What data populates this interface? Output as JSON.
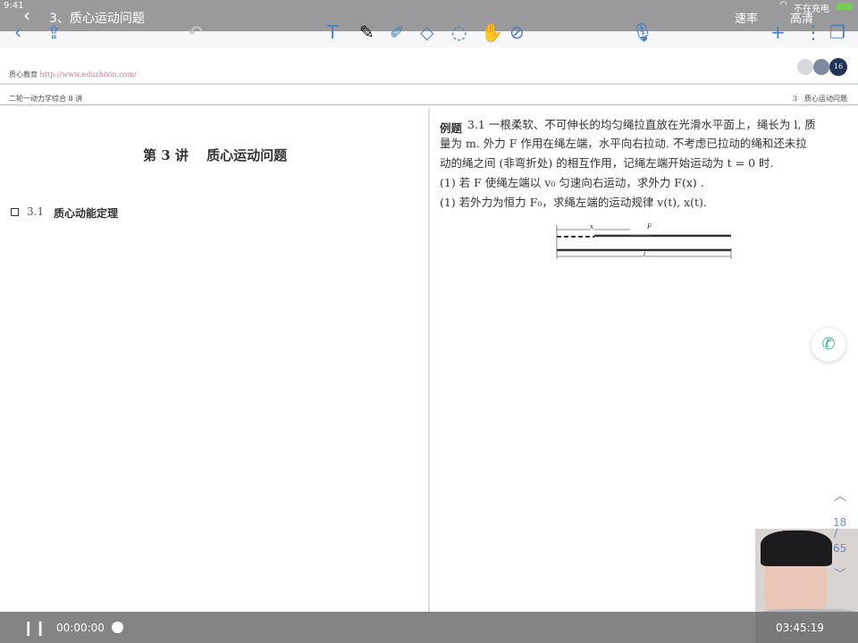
{
  "status": {
    "time": "9:41",
    "charging": "不在充电"
  },
  "nav": {
    "title": "3、质心运动问题",
    "speed": "速率",
    "quality": "高清"
  },
  "doc": {
    "brand": "质心教育",
    "url": "http://www.eduzhixin.com/",
    "page_badge": "16",
    "left_header": "二轮一动力学综合 8 讲",
    "right_header": "3　质心运动问题",
    "lecture_title": "第 3 讲　 质心运动问题",
    "section_num": "3.1",
    "section_title": "质心动能定理",
    "example_label": "例题",
    "example_lines": [
      "3.1 一根柔软、不可伸长的均匀绳拉直放在光滑水平面上，绳长为 l, 质",
      "量为 m. 外力 F 作用在绳左端，水平向右拉动. 不考虑已拉动的绳和还未拉",
      "动的绳之间 (非弯折处) 的相互作用，记绳左端开始运动为 t = 0 时.",
      "(1) 若 F 使绳左端以 v₀ 匀速向右运动，求外力 F(x) .",
      "(1) 若外力为恒力 F₀，求绳左端的运动规律 v(t), x(t)."
    ],
    "fig_x": "x",
    "fig_F": "F",
    "fig_l": "l"
  },
  "pager": {
    "current": "18",
    "total": "65"
  },
  "player": {
    "elapsed": "00:00:00",
    "total": "03:45:19"
  }
}
